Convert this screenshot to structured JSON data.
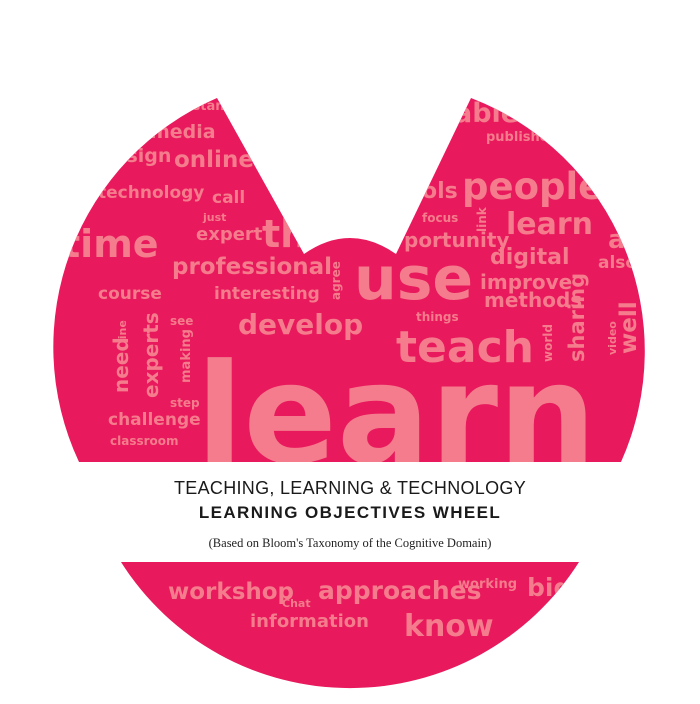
{
  "colors": {
    "accent": "#e8195d",
    "words": "#f47c8c",
    "caption_text": "#1a1a1a"
  },
  "upper_words": [
    "derstand",
    "able",
    "media",
    "published",
    "design",
    "online",
    "ols",
    "people",
    "technology",
    "call",
    "just",
    "focus",
    "link",
    "learn",
    "time",
    "expert",
    "th",
    "portunity",
    "ad",
    "digital",
    "professional",
    "use",
    "also",
    "agree",
    "improve",
    "course",
    "interesting",
    "methods",
    "things",
    "see",
    "develop",
    "line",
    "world",
    "sharing",
    "video",
    "well",
    "teach",
    "need",
    "experts",
    "making",
    "step",
    "challenge",
    "classroom",
    "learn"
  ],
  "lower_words": [
    "workshop",
    "Chat",
    "approaches",
    "working",
    "big",
    "information",
    "know"
  ],
  "caption": {
    "line1": "TEACHING, LEARNING & TECHNOLOGY",
    "line2": "LEARNING OBJECTIVES WHEEL",
    "line3": "(Based on Bloom's Taxonomy of the Cognitive Domain)"
  }
}
